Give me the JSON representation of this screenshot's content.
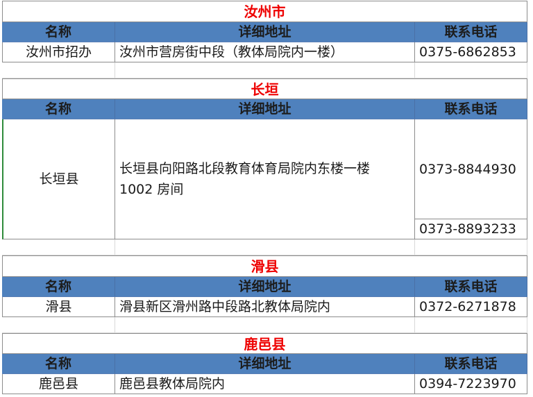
{
  "headers": {
    "name": "名称",
    "address": "详细地址",
    "phone": "联系电话"
  },
  "sections": [
    {
      "title": "汝州市",
      "name": "汝州市招办",
      "address": "汝州市营房街中段（教体局院内一楼）",
      "phones": [
        "0375-6862853"
      ]
    },
    {
      "title": "长垣",
      "name": "长垣县",
      "address": "长垣县向阳路北段教育体育局院内东楼一楼 1002 房间",
      "phones": [
        "0373-8844930",
        "0373-8893233"
      ]
    },
    {
      "title": "滑县",
      "name": "滑县",
      "address": "滑县新区滑州路中段路北教体局院内",
      "phones": [
        "0372-6271878"
      ]
    },
    {
      "title": "鹿邑县",
      "name": "鹿邑县",
      "address": "鹿邑县教体局院内",
      "phones": [
        "0394-7223970"
      ]
    }
  ]
}
